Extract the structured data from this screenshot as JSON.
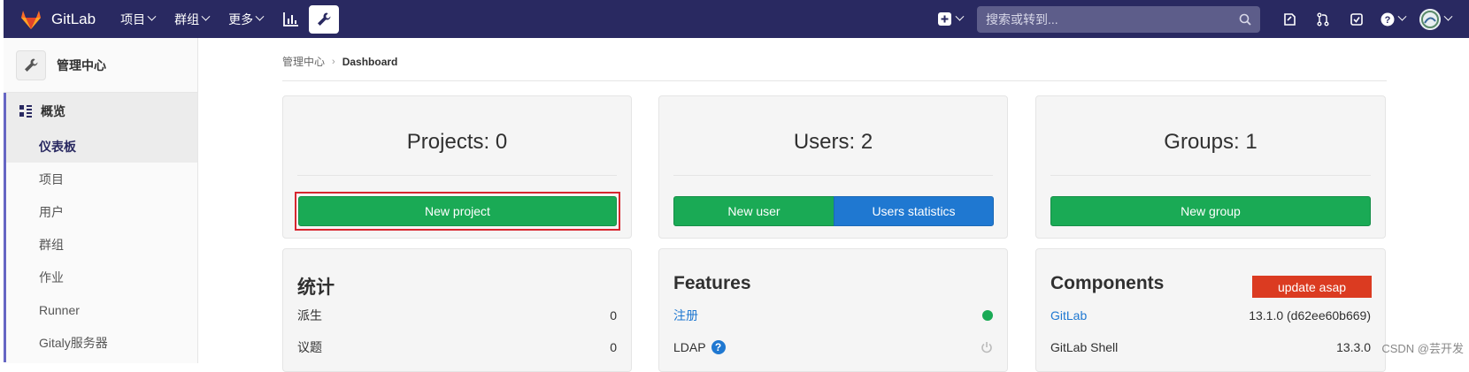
{
  "topbar": {
    "brand": "GitLab",
    "menu": [
      "项目",
      "群组",
      "更多"
    ],
    "search_placeholder": "搜索或转到..."
  },
  "sidebar": {
    "title": "管理中心",
    "section": "概览",
    "items": [
      "仪表板",
      "项目",
      "用户",
      "群组",
      "作业",
      "Runner",
      "Gitaly服务器"
    ]
  },
  "breadcrumb": {
    "root": "管理中心",
    "current": "Dashboard"
  },
  "cards": {
    "projects": {
      "title": "Projects: 0",
      "button": "New project"
    },
    "users": {
      "title": "Users: 2",
      "button1": "New user",
      "button2": "Users statistics"
    },
    "groups": {
      "title": "Groups: 1",
      "button": "New group"
    }
  },
  "stats": {
    "title": "统计",
    "rows": [
      {
        "label": "派生",
        "value": "0"
      },
      {
        "label": "议题",
        "value": "0"
      }
    ]
  },
  "features": {
    "title": "Features",
    "rows": [
      {
        "label": "注册"
      },
      {
        "label": "LDAP"
      }
    ]
  },
  "components": {
    "title": "Components",
    "badge": "update asap",
    "rows": [
      {
        "label": "GitLab",
        "value": "13.1.0 (d62ee60b669)"
      },
      {
        "label": "GitLab Shell",
        "value": "13.3.0"
      }
    ]
  },
  "watermark": "CSDN @芸开发",
  "colors": {
    "navbar": "#292961",
    "green": "#1aaa55",
    "blue": "#1f78d1",
    "red": "#db3b21",
    "highlight": "#d7262f"
  }
}
